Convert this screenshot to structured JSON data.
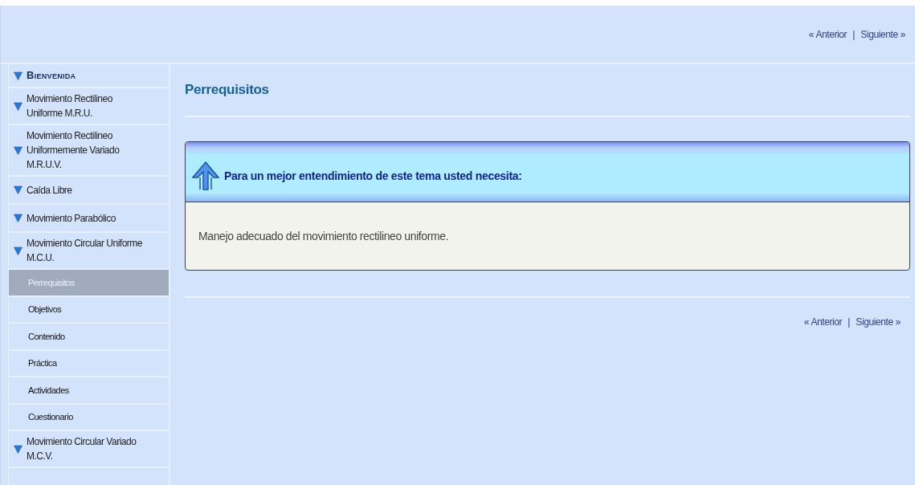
{
  "top_nav": {
    "previous": "« Anterior",
    "separator": "|",
    "next": "Siguiente »"
  },
  "sidebar": {
    "items": [
      {
        "label": "Bienvenida",
        "kind": "heading",
        "selected": false
      },
      {
        "label": "Movimiento Rectilineo Uniforme M.R.U.",
        "kind": "section",
        "selected": false
      },
      {
        "label": "Movimiento Rectilineo Uniformemente Variado M.R.U.V.",
        "kind": "section",
        "selected": false
      },
      {
        "label": "Caída Libre",
        "kind": "section",
        "selected": false
      },
      {
        "label": "Movimiento Parabólico",
        "kind": "section",
        "selected": false
      },
      {
        "label": "Movimiento Circular Uniforme M.C.U.",
        "kind": "section",
        "selected": false
      },
      {
        "label": "Perrequisitos",
        "kind": "sub",
        "selected": true
      },
      {
        "label": "Objetivos",
        "kind": "sub",
        "selected": false
      },
      {
        "label": "Contenido",
        "kind": "sub",
        "selected": false
      },
      {
        "label": "Práctica",
        "kind": "sub",
        "selected": false
      },
      {
        "label": "Actividades",
        "kind": "sub",
        "selected": false
      },
      {
        "label": "Cuestionario",
        "kind": "sub",
        "selected": false
      },
      {
        "label": "Movimiento Circular Variado M.C.V.",
        "kind": "section",
        "selected": false
      }
    ]
  },
  "content": {
    "title": "Perrequisitos",
    "panel": {
      "heading": "Para un mejor entendimiento de este tema usted necesita:",
      "body": "Manejo adecuado del movimiento rectilineo uniforme."
    }
  },
  "bottom_nav": {
    "previous": "« Anterior",
    "separator": "|",
    "next": "Siguiente »"
  }
}
